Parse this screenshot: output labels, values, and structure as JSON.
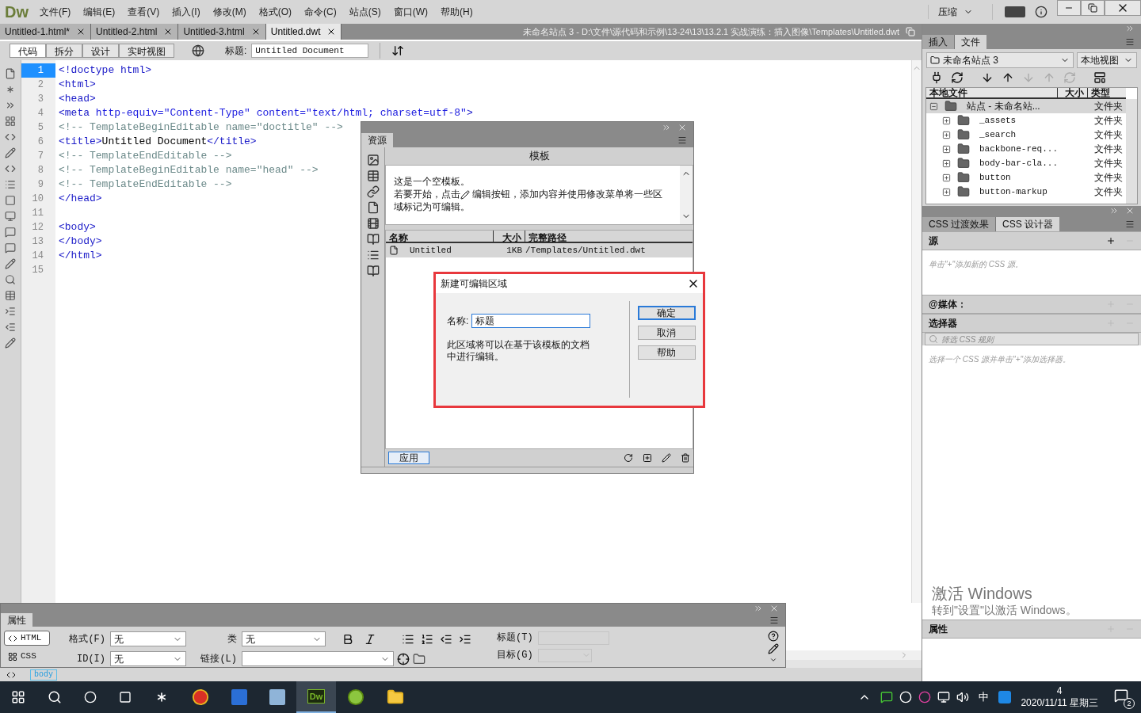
{
  "menubar": {
    "logo": "Dw",
    "menus": [
      "文件(F)",
      "编辑(E)",
      "查看(V)",
      "插入(I)",
      "修改(M)",
      "格式(O)",
      "命令(C)",
      "站点(S)",
      "窗口(W)",
      "帮助(H)"
    ],
    "workspace": "压缩"
  },
  "doc_tabs": [
    {
      "label": "Untitled-1.html*",
      "selected": false
    },
    {
      "label": "Untitled-2.html",
      "selected": false
    },
    {
      "label": "Untitled-3.html",
      "selected": false
    },
    {
      "label": "Untitled.dwt",
      "selected": true
    }
  ],
  "doc_path": "未命名站点 3 - D:\\文件\\源代码和示例\\13-24\\13\\13.2.1 实战演练：插入图像\\Templates\\Untitled.dwt",
  "view_buttons": [
    {
      "label": "代码",
      "selected": true
    },
    {
      "label": "拆分",
      "selected": false
    },
    {
      "label": "设计",
      "selected": false
    },
    {
      "label": "实时视图",
      "selected": false
    }
  ],
  "title_field": {
    "label": "标题:",
    "value": "Untitled Document"
  },
  "code_lines": [
    {
      "number": "1",
      "selected": true,
      "segments": [
        {
          "kind": "tag",
          "text": "<!doctype html>"
        }
      ]
    },
    {
      "number": "2",
      "selected": false,
      "segments": [
        {
          "kind": "tag",
          "text": "<html>"
        }
      ]
    },
    {
      "number": "3",
      "selected": false,
      "segments": [
        {
          "kind": "tag",
          "text": "<head>"
        }
      ]
    },
    {
      "number": "4",
      "selected": false,
      "segments": [
        {
          "kind": "tag",
          "text": "<meta"
        },
        {
          "kind": "attr",
          "text": " http-equiv="
        },
        {
          "kind": "value",
          "text": "\"Content-Type\""
        },
        {
          "kind": "attr",
          "text": " content="
        },
        {
          "kind": "value",
          "text": "\"text/html; charset=utf-8\""
        },
        {
          "kind": "tag",
          "text": ">"
        }
      ]
    },
    {
      "number": "5",
      "selected": false,
      "segments": [
        {
          "kind": "comment",
          "text": "<!-- TemplateBeginEditable name=\"doctitle\" -->"
        }
      ]
    },
    {
      "number": "6",
      "selected": false,
      "segments": [
        {
          "kind": "tag",
          "text": "<title>"
        },
        {
          "kind": "text",
          "text": "Untitled Document"
        },
        {
          "kind": "tag",
          "text": "</title>"
        }
      ]
    },
    {
      "number": "7",
      "selected": false,
      "segments": [
        {
          "kind": "comment",
          "text": "<!-- TemplateEndEditable -->"
        }
      ]
    },
    {
      "number": "8",
      "selected": false,
      "segments": [
        {
          "kind": "comment",
          "text": "<!-- TemplateBeginEditable name=\"head\" -->"
        }
      ]
    },
    {
      "number": "9",
      "selected": false,
      "segments": [
        {
          "kind": "comment",
          "text": "<!-- TemplateEndEditable -->"
        }
      ]
    },
    {
      "number": "10",
      "selected": false,
      "segments": [
        {
          "kind": "tag",
          "text": "</head>"
        }
      ]
    },
    {
      "number": "11",
      "selected": false
    },
    {
      "number": "12",
      "selected": false,
      "segments": [
        {
          "kind": "tag",
          "text": "<body>"
        }
      ]
    },
    {
      "number": "13",
      "selected": false,
      "segments": [
        {
          "kind": "tag",
          "text": "</body>"
        }
      ]
    },
    {
      "number": "14",
      "selected": false,
      "segments": [
        {
          "kind": "tag",
          "text": "</html>"
        }
      ]
    },
    {
      "number": "15",
      "selected": false
    }
  ],
  "assets_panel": {
    "tab": "资源",
    "heading": "模板",
    "intro": "这是一个空模板。",
    "before_icon": "若要开始，点击",
    "after_icon": " 编辑按钮，添加内容并使用修改菜单将一些区域标记为可编辑。",
    "columns": [
      "名称",
      "大小",
      "完整路径"
    ],
    "rows": [
      {
        "name": "Untitled",
        "size": "1KB",
        "path": "/Templates/Untitled.dwt"
      }
    ],
    "apply": "应用"
  },
  "dialog": {
    "title": "新建可编辑区域",
    "name_label": "名称:",
    "name_value": "标题",
    "note": "此区域将可以在基于该模板的文档中进行编辑。",
    "buttons": [
      {
        "label": "确定",
        "selected": true
      },
      {
        "label": "取消",
        "selected": false
      },
      {
        "label": "帮助",
        "selected": false
      }
    ]
  },
  "properties": {
    "tab": "属性",
    "modes": [
      {
        "label": "HTML",
        "selected": true
      },
      {
        "label": "CSS",
        "selected": false
      }
    ],
    "format": {
      "label": "格式(F)",
      "value": "无"
    },
    "id": {
      "label": "ID(I)",
      "value": "无"
    },
    "class": {
      "label": "类",
      "value": "无"
    },
    "link": {
      "label": "链接(L)"
    },
    "title": {
      "label": "标题(T)",
      "disabled": true
    },
    "target": {
      "label": "目标(G)",
      "disabled": true
    },
    "tag": "body"
  },
  "files_panel": {
    "tabs": [
      {
        "label": "插入",
        "selected": false
      },
      {
        "label": "文件",
        "selected": true
      }
    ],
    "site": "未命名站点 3",
    "view": "本地视图",
    "columns": [
      "本地文件",
      "大小",
      "类型"
    ],
    "tree": [
      {
        "name": "站点 - 未命名站...",
        "type": "文件夹",
        "expanded": true,
        "selected": true,
        "children": [
          {
            "name": "_assets",
            "type": "文件夹",
            "expanded": false,
            "selected": false
          },
          {
            "name": "_search",
            "type": "文件夹",
            "expanded": false,
            "selected": false
          },
          {
            "name": "backbone-req...",
            "type": "文件夹",
            "expanded": false,
            "selected": false
          },
          {
            "name": "body-bar-cla...",
            "type": "文件夹",
            "expanded": false,
            "selected": false
          },
          {
            "name": "button",
            "type": "文件夹",
            "expanded": false,
            "selected": false
          },
          {
            "name": "button-markup",
            "type": "文件夹",
            "expanded": false,
            "selected": false
          }
        ]
      }
    ]
  },
  "css_panel": {
    "tabs": [
      {
        "label": "CSS 过渡效果",
        "selected": false
      },
      {
        "label": "CSS 设计器",
        "selected": true
      }
    ],
    "sources": {
      "label": "源",
      "hint": "单击\"+\"添加新的 CSS 源。"
    },
    "media": {
      "label": "@媒体："
    },
    "selectors": {
      "label": "选择器",
      "placeholder": "筛选 CSS 规则",
      "hint": "选择一个 CSS 源并单击\"+\"添加选择器。"
    },
    "properties": {
      "label": "属性"
    }
  },
  "activation": {
    "title": "激活 Windows",
    "text": "转到\"设置\"以激活 Windows。"
  },
  "taskbar": {
    "active_app": "Dw",
    "ime": "中",
    "clock": "4",
    "date": "2020/11/11 星期三",
    "notifications": "2"
  }
}
